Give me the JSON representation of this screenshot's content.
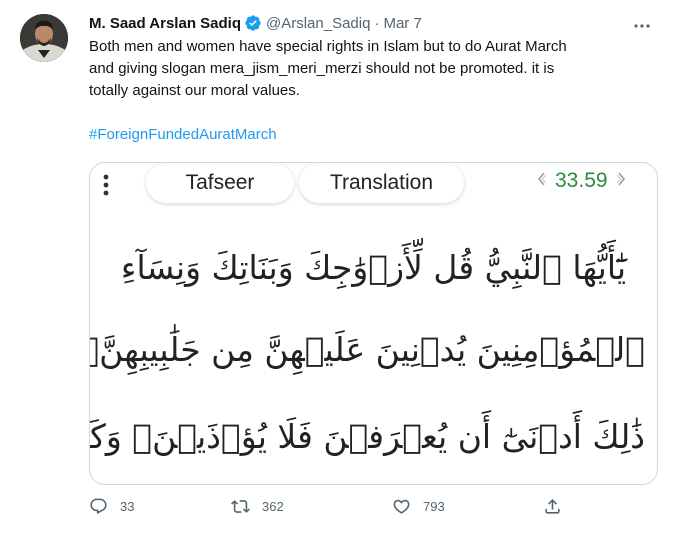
{
  "tweet": {
    "author_name": "M. Saad Arslan Sadiq",
    "handle": "@Arslan_Sadiq",
    "separator": "·",
    "date": "Mar 7",
    "text_lines": [
      "Both men and women have special rights in Islam but to do Aurat March",
      "and giving slogan mera_jism_meri_merzi should not be  promoted. it is",
      "totally against our moral values."
    ],
    "hashtag": "#ForeignFundedAuratMarch"
  },
  "media": {
    "tab_tafseer": "Tafseer",
    "tab_translation": "Translation",
    "verse_number": "33.59",
    "arabic_lines": [
      "يَٰٓأَيُّهَا ٱلنَّبِيُّ قُل لِّأَزۡوَٰجِكَ وَبَنَاتِكَ وَنِسَآءِ",
      "ٱلۡمُؤۡمِنِينَ يُدۡنِينَ عَلَيۡهِنَّ مِن جَلَٰبِيبِهِنَّۚ",
      "ذَٰلِكَ أَدۡنَىٰٓ أَن يُعۡرَفۡنَ فَلَا يُؤۡذَيۡنَۗ وَكَانَ ٱللَّهُ غَفُورٗا"
    ]
  },
  "actions": {
    "reply_count": "33",
    "retweet_count": "362",
    "like_count": "793"
  },
  "colors": {
    "accent": "#1d9bf0",
    "verse_green": "#2e8b3a",
    "secondary_text": "#536471"
  },
  "icons": [
    "verified-badge-icon",
    "more-icon",
    "kebab-menu-icon",
    "chevron-left-icon",
    "chevron-right-icon",
    "reply-icon",
    "retweet-icon",
    "like-icon",
    "share-icon"
  ]
}
